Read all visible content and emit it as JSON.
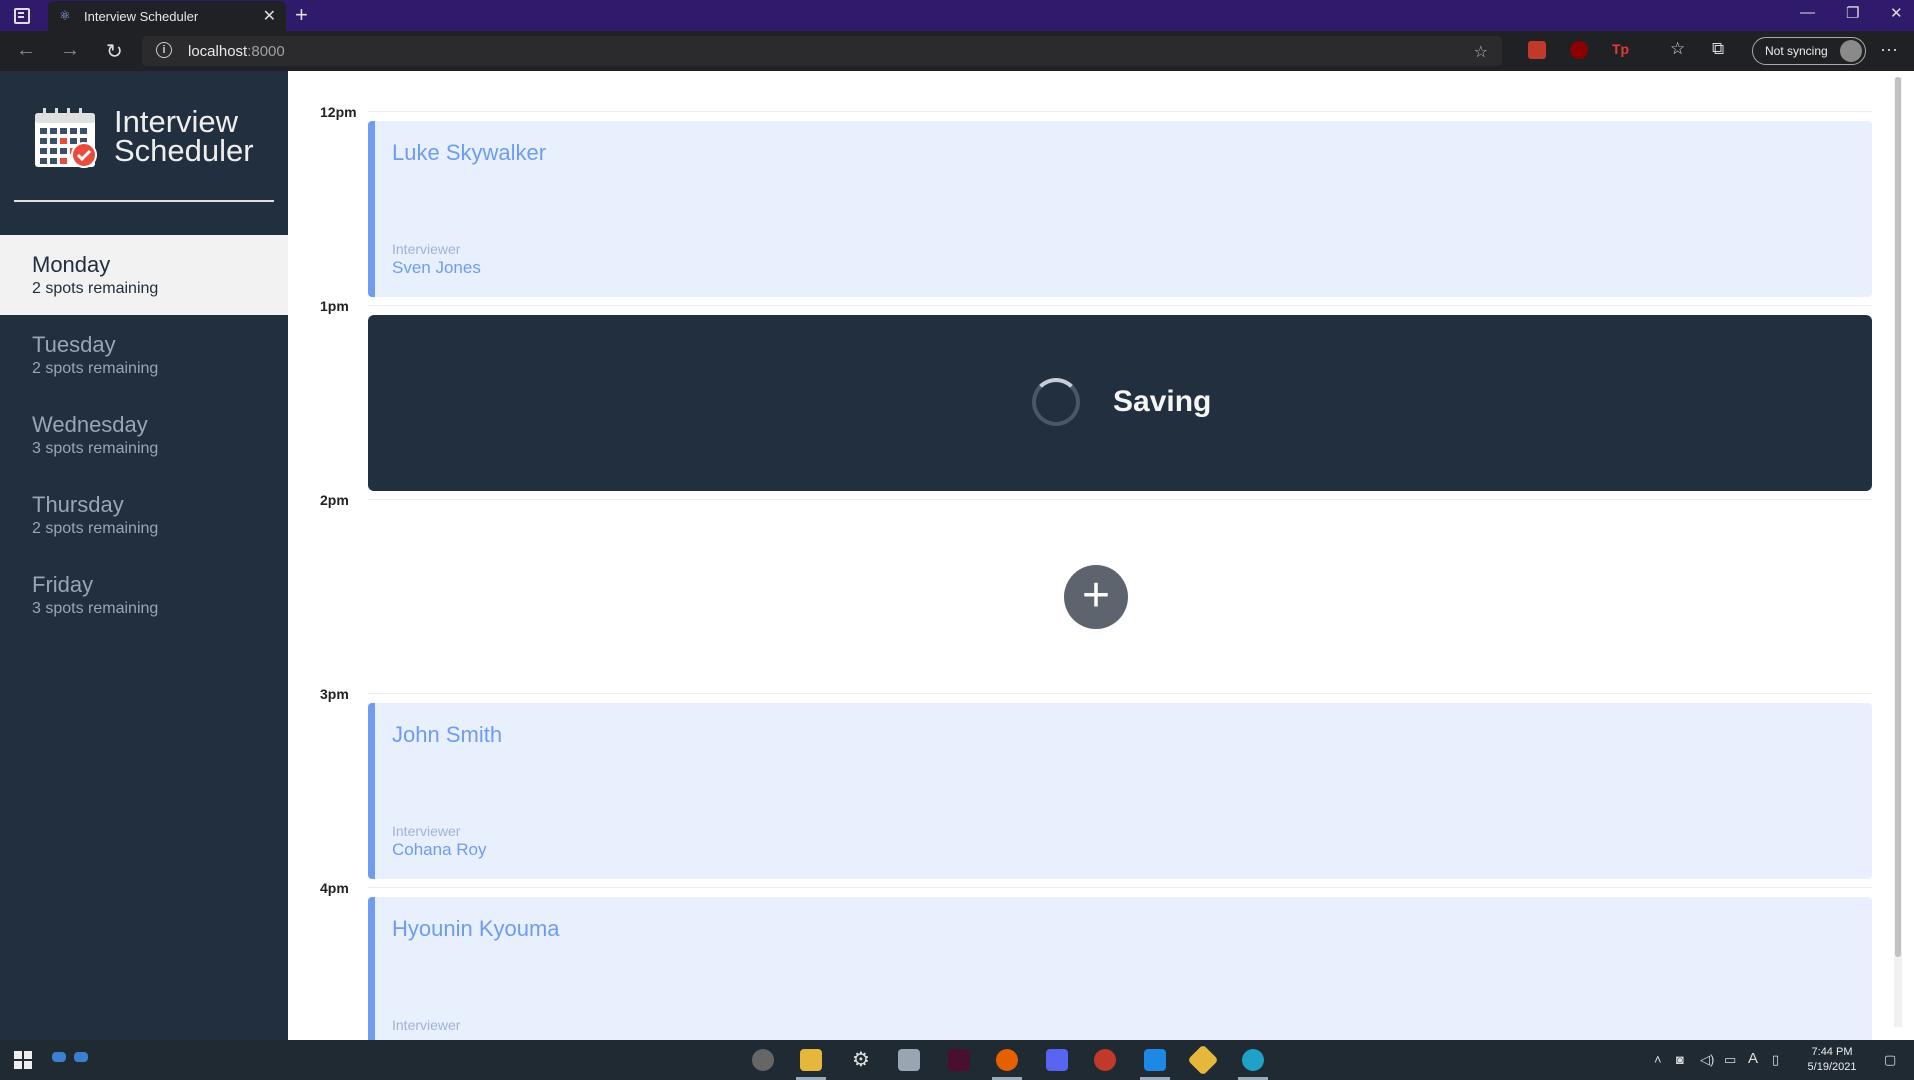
{
  "browser": {
    "tab_title": "Interview Scheduler",
    "url_host": "localhost",
    "url_port": ":8000",
    "sync_label": "Not syncing"
  },
  "app": {
    "brand_line1": "Interview",
    "brand_line2": "Scheduler",
    "days": [
      {
        "name": "Monday",
        "spots": "2 spots remaining",
        "selected": true
      },
      {
        "name": "Tuesday",
        "spots": "2 spots remaining",
        "selected": false
      },
      {
        "name": "Wednesday",
        "spots": "3 spots remaining",
        "selected": false
      },
      {
        "name": "Thursday",
        "spots": "2 spots remaining",
        "selected": false
      },
      {
        "name": "Friday",
        "spots": "3 spots remaining",
        "selected": false
      }
    ],
    "hours": [
      "12pm",
      "1pm",
      "2pm",
      "3pm",
      "4pm"
    ],
    "appointments": [
      {
        "time": "12pm",
        "student": "Luke Skywalker",
        "interviewer_label": "Interviewer",
        "interviewer": "Sven Jones"
      },
      {
        "time": "1pm",
        "status": "Saving"
      },
      {
        "time": "2pm",
        "empty": true
      },
      {
        "time": "3pm",
        "student": "John Smith",
        "interviewer_label": "Interviewer",
        "interviewer": "Cohana Roy"
      },
      {
        "time": "4pm",
        "student": "Hyounin Kyouma",
        "interviewer_label": "Interviewer",
        "interviewer": ""
      }
    ],
    "add_icon": "plus-icon"
  },
  "taskbar": {
    "time": "7:44 PM",
    "date": "5/19/2021"
  },
  "colors": {
    "sidebar": "#222f3e",
    "appointment_bg": "#e8f0fd",
    "appointment_accent": "#6f9cef",
    "saving_bg": "#222f3e",
    "add_button": "#5d646d",
    "titlebar": "#2f1a6b"
  }
}
